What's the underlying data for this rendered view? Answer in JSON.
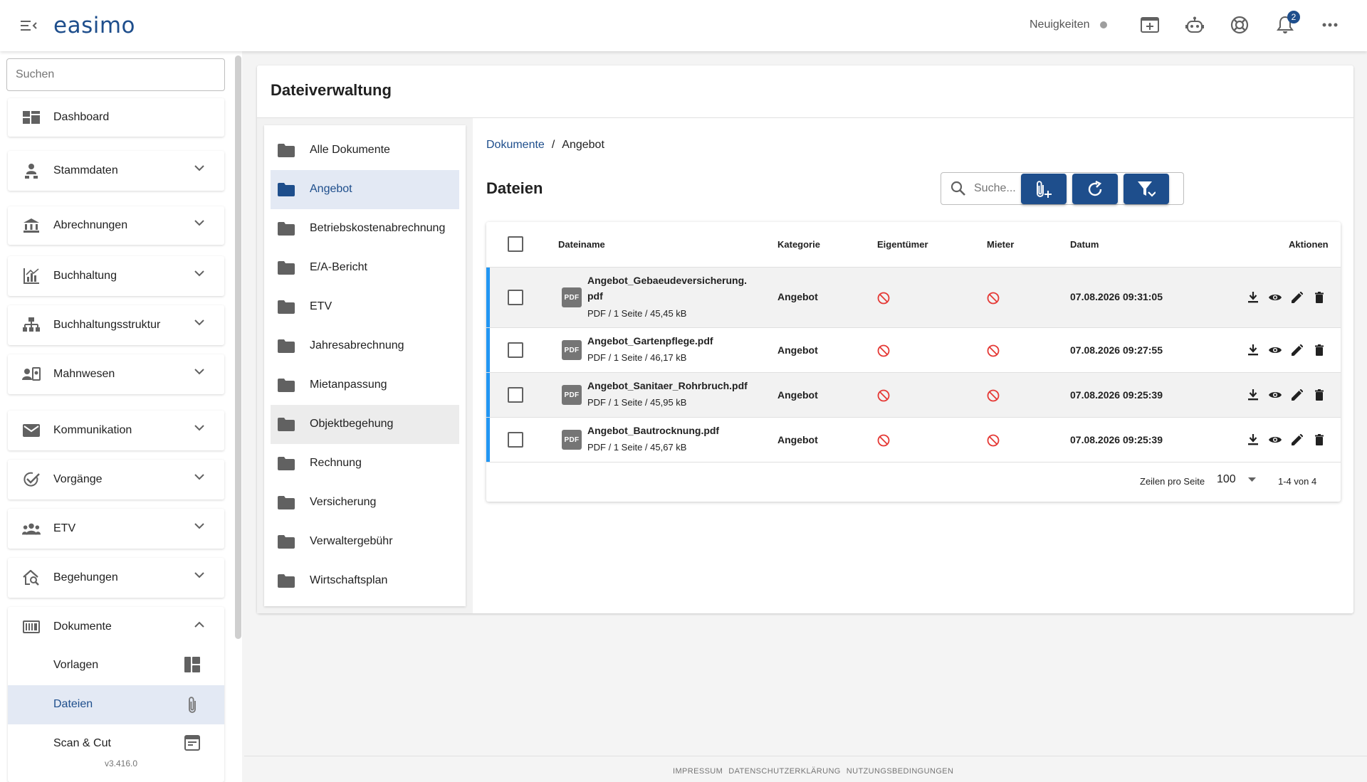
{
  "header": {
    "logo": "easimo",
    "news_label": "Neuigkeiten",
    "notification_count": "2"
  },
  "sidebar": {
    "search_placeholder": "Suchen",
    "items": [
      {
        "label": "Dashboard",
        "icon": "dashboard-icon"
      },
      {
        "label": "Stammdaten",
        "icon": "person-tree-icon"
      },
      {
        "label": "Abrechnungen",
        "icon": "bank-icon"
      },
      {
        "label": "Buchhaltung",
        "icon": "chart-icon"
      },
      {
        "label": "Buchhaltungsstruktur",
        "icon": "hierarchy-icon"
      },
      {
        "label": "Mahnwesen",
        "icon": "contact-card-icon"
      },
      {
        "label": "Kommunikation",
        "icon": "mail-icon"
      },
      {
        "label": "Vorgänge",
        "icon": "task-check-icon"
      },
      {
        "label": "ETV",
        "icon": "group-icon"
      },
      {
        "label": "Begehungen",
        "icon": "home-search-icon"
      },
      {
        "label": "Dokumente",
        "icon": "documents-icon"
      }
    ],
    "sub_items": [
      {
        "label": "Vorlagen",
        "icon": "template-icon"
      },
      {
        "label": "Dateien",
        "icon": "paperclip-icon"
      },
      {
        "label": "Scan & Cut",
        "icon": "scan-icon"
      }
    ],
    "version": "v3.416.0"
  },
  "main": {
    "title": "Dateiverwaltung",
    "folders": [
      "Alle Dokumente",
      "Angebot",
      "Betriebskostenabrechnung",
      "E/A-Bericht",
      "ETV",
      "Jahresabrechnung",
      "Mietanpassung",
      "Objektbegehung",
      "Rechnung",
      "Versicherung",
      "Verwaltergebühr",
      "Wirtschaftsplan"
    ],
    "selected_folder": "Angebot",
    "breadcrumb": {
      "root": "Dokumente",
      "separator": "/",
      "current": "Angebot"
    },
    "files_title": "Dateien",
    "search_placeholder": "Suche...",
    "table": {
      "columns": [
        "Dateiname",
        "Kategorie",
        "Eigentümer",
        "Mieter",
        "Datum",
        "Aktionen"
      ],
      "rows": [
        {
          "name_line1": "Angebot_Gebaeudeversicherung.",
          "name_line2": "pdf",
          "meta": "PDF / 1 Seite / 45,45 kB",
          "category": "Angebot",
          "date": "07.08.2026 09:31:05"
        },
        {
          "name_line1": "Angebot_Gartenpflege.pdf",
          "name_line2": "",
          "meta": "PDF / 1 Seite / 46,17 kB",
          "category": "Angebot",
          "date": "07.08.2026 09:27:55"
        },
        {
          "name_line1": "Angebot_Sanitaer_Rohrbruch.pdf",
          "name_line2": "",
          "meta": "PDF / 1 Seite / 45,95 kB",
          "category": "Angebot",
          "date": "07.08.2026 09:25:39"
        },
        {
          "name_line1": "Angebot_Bautrocknung.pdf",
          "name_line2": "",
          "meta": "PDF / 1 Seite / 45,67 kB",
          "category": "Angebot",
          "date": "07.08.2026 09:25:39"
        }
      ],
      "file_badge": "PDF",
      "rows_per_page_label": "Zeilen pro Seite",
      "rows_per_page": "100",
      "range": "1-4 von 4"
    }
  },
  "footer": {
    "links": [
      "IMPRESSUM",
      "DATENSCHUTZERKLÄRUNG",
      "NUTZUNGSBEDINGUNGEN"
    ]
  },
  "colors": {
    "brand": "#1e4e8c",
    "accent": "#2196f3",
    "danger": "#e53935"
  }
}
